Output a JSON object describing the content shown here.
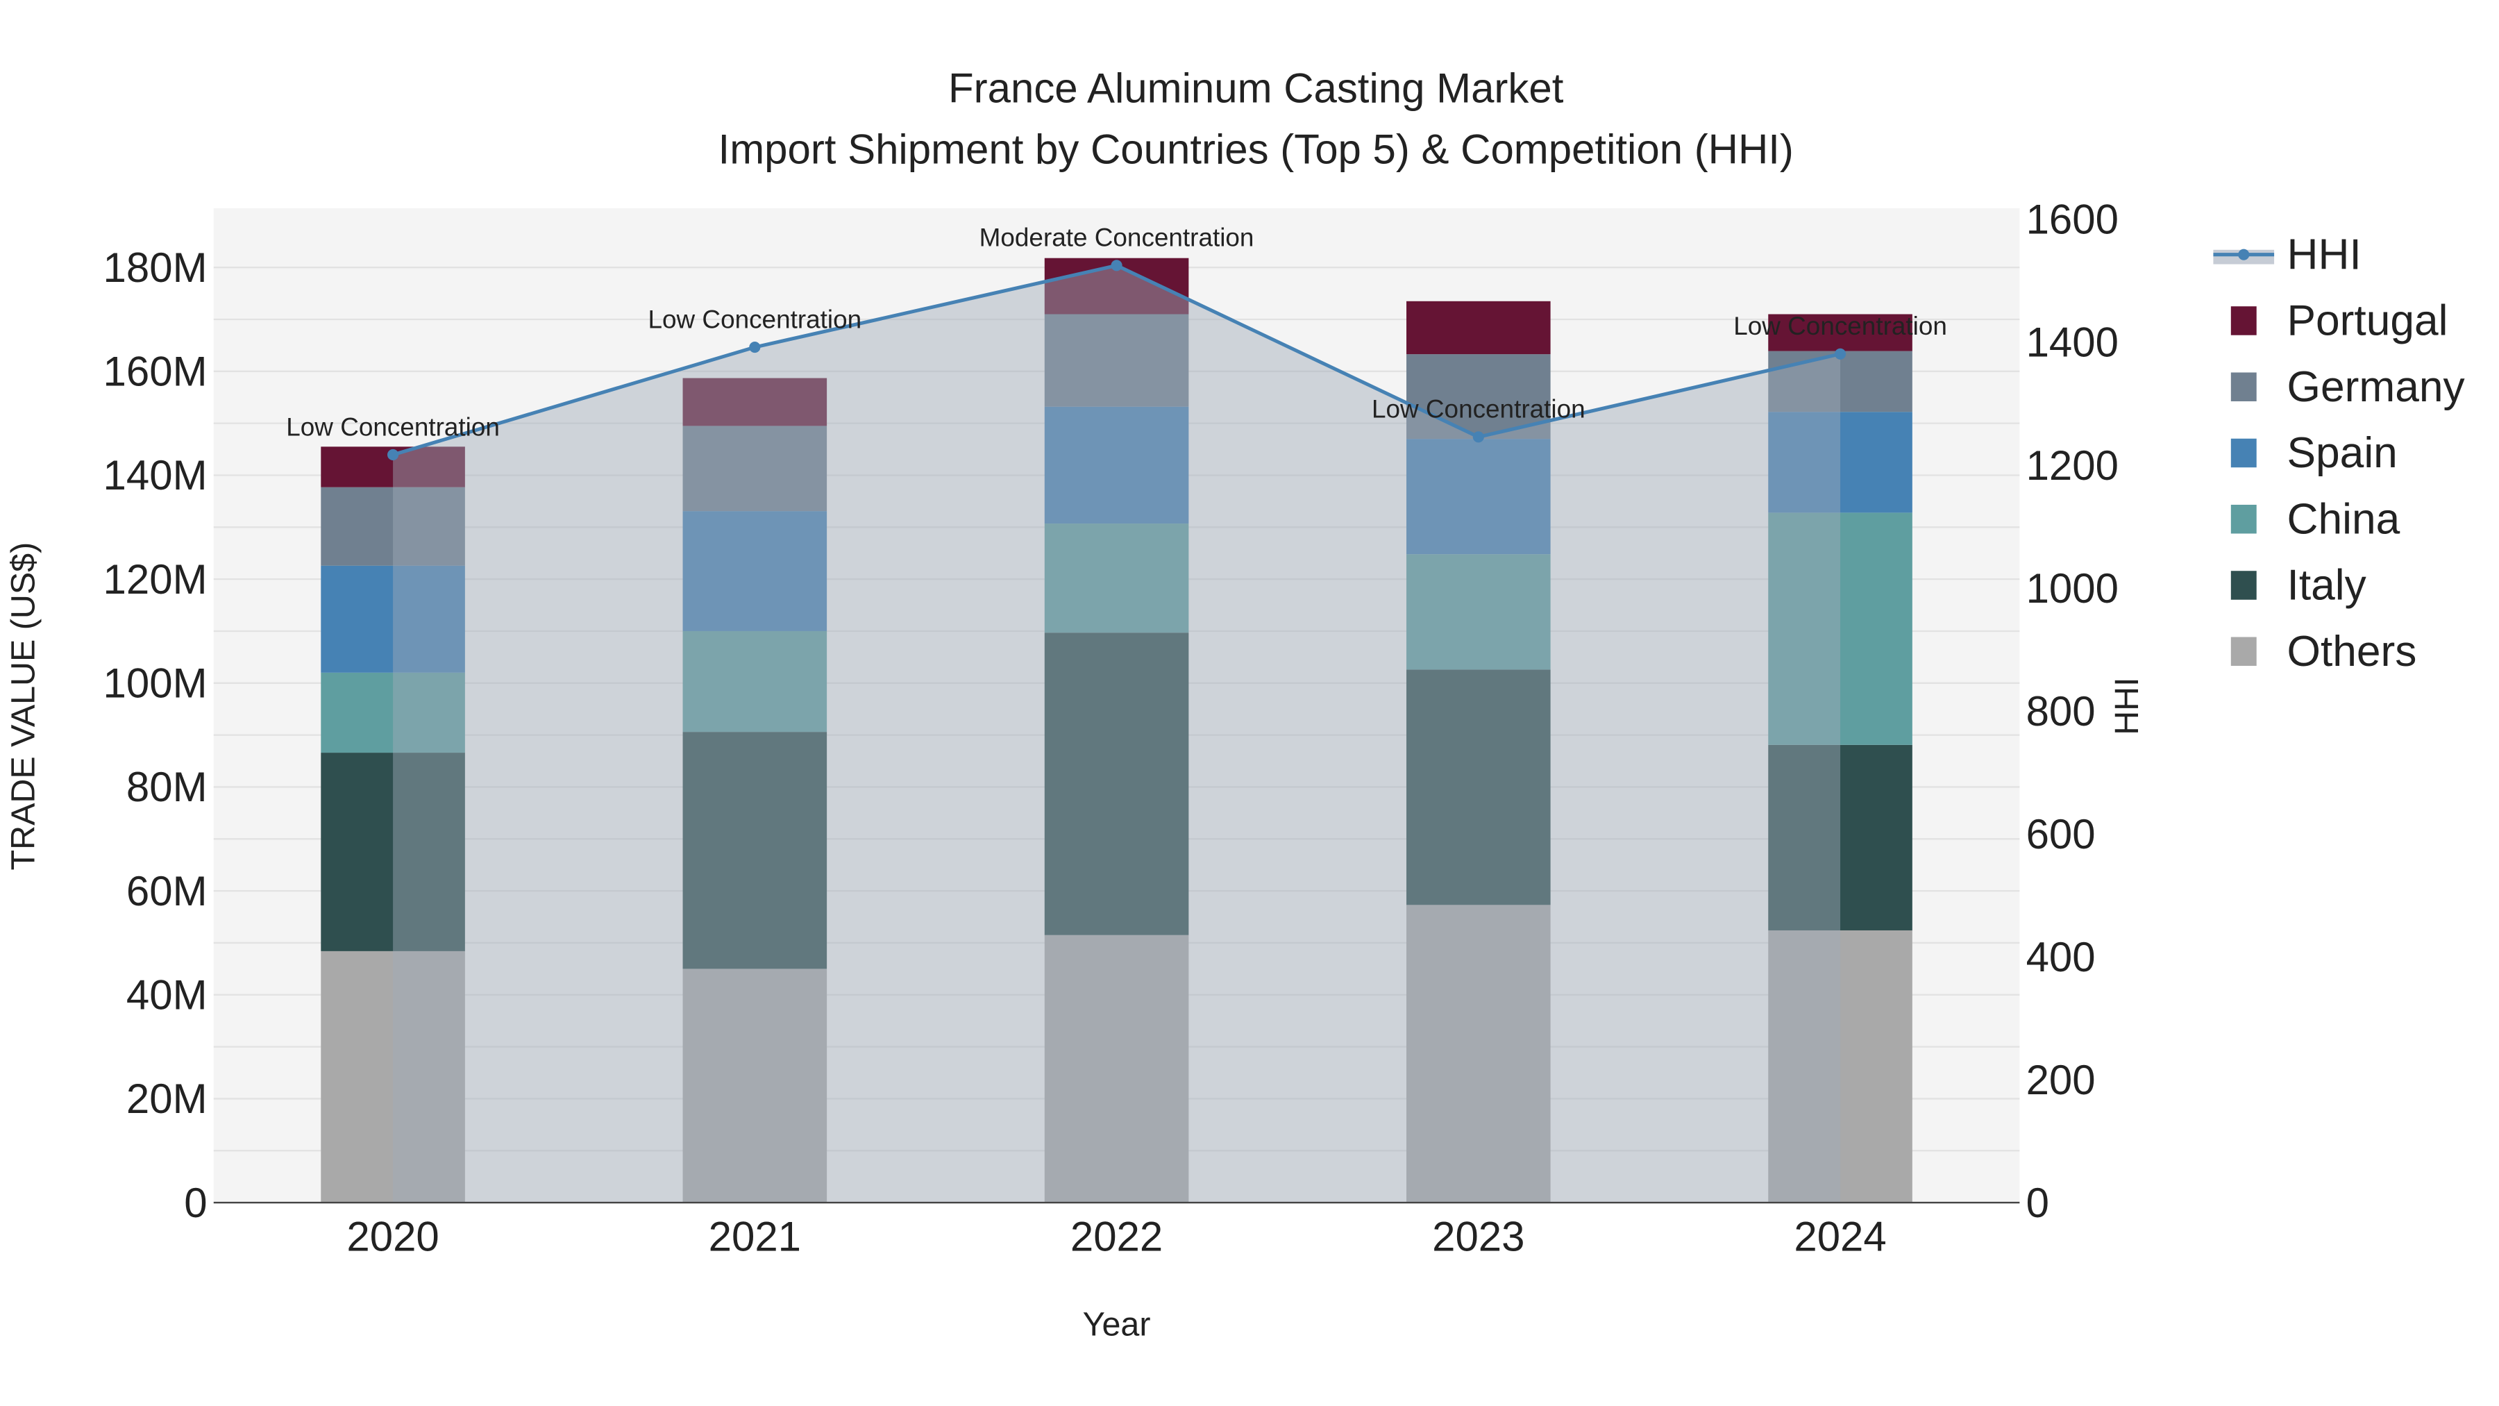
{
  "chart_data": {
    "type": "bar",
    "title": "France Aluminum Casting Market",
    "subtitle": "Import Shipment by Countries (Top 5) & Competition (HHI)",
    "xlabel": "Year",
    "ylabel": "TRADE VALUE (US$)",
    "y2label": "HHI",
    "ylim": [
      0,
      190000000
    ],
    "y2lim": [
      0,
      1650
    ],
    "yticks": [
      "0",
      "20M",
      "40M",
      "60M",
      "80M",
      "100M",
      "120M",
      "140M",
      "160M",
      "180M"
    ],
    "y2ticks": [
      "0",
      "200",
      "400",
      "600",
      "800",
      "1000",
      "1200",
      "1400",
      "1600"
    ],
    "categories": [
      "2020",
      "2021",
      "2022",
      "2023",
      "2024"
    ],
    "series": [
      {
        "name": "Others",
        "color": "#a9a9a9",
        "values": [
          48.4,
          45.0,
          51.5,
          57.3,
          52.4
        ]
      },
      {
        "name": "Italy",
        "color": "#2f4f4f",
        "values": [
          38.2,
          45.6,
          58.2,
          45.3,
          35.7
        ]
      },
      {
        "name": "China",
        "color": "#5f9ea0",
        "values": [
          15.4,
          19.4,
          21.0,
          22.2,
          44.7
        ]
      },
      {
        "name": "Spain",
        "color": "#4682b4",
        "values": [
          20.6,
          23.1,
          22.5,
          22.2,
          19.4
        ]
      },
      {
        "name": "Germany",
        "color": "#708090",
        "values": [
          15.1,
          16.4,
          17.8,
          16.3,
          11.7
        ]
      },
      {
        "name": "Portugal",
        "color": "#651434",
        "values": [
          7.8,
          9.2,
          10.8,
          10.2,
          7.1
        ]
      }
    ],
    "value_unit": "million US$",
    "hhi": {
      "name": "HHI",
      "color": "#4682b4",
      "values": [
        1217,
        1392,
        1525,
        1246,
        1381
      ],
      "labels": [
        "Low Concentration",
        "Low Concentration",
        "Moderate Concentration",
        "Low Concentration",
        "Low Concentration"
      ]
    },
    "legend": [
      "HHI",
      "Portugal",
      "Germany",
      "Spain",
      "China",
      "Italy",
      "Others"
    ],
    "legend_position": "right",
    "grid": true
  }
}
